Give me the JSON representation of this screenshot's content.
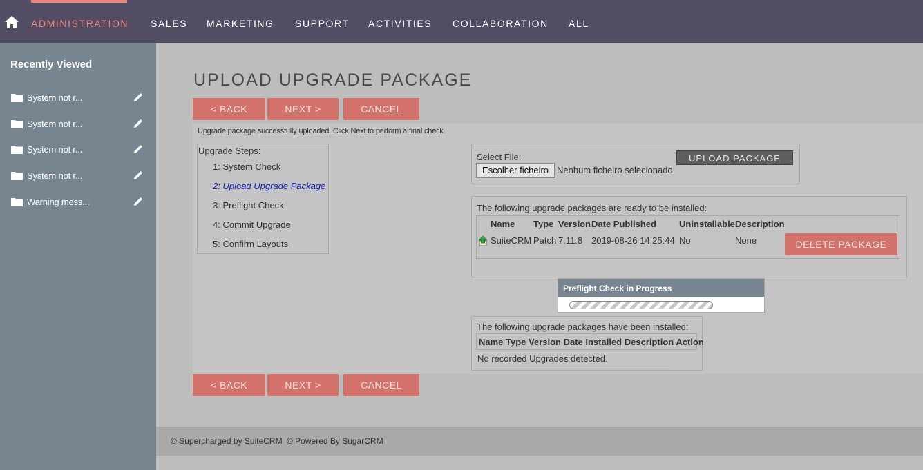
{
  "nav": {
    "items": [
      "ADMINISTRATION",
      "SALES",
      "MARKETING",
      "SUPPORT",
      "ACTIVITIES",
      "COLLABORATION",
      "ALL"
    ],
    "active": "ADMINISTRATION",
    "accent": "#f08377",
    "background": "#534d64"
  },
  "sidebar": {
    "title": "Recently Viewed",
    "items": [
      {
        "label": "System not r..."
      },
      {
        "label": "System not r..."
      },
      {
        "label": "System not r..."
      },
      {
        "label": "System not r..."
      },
      {
        "label": "Warning mess..."
      }
    ]
  },
  "page": {
    "title": "UPLOAD UPGRADE PACKAGE",
    "back_label": "< BACK",
    "next_label": "NEXT >",
    "cancel_label": "CANCEL",
    "message": "Upgrade package successfully uploaded. Click Next to perform a final check."
  },
  "steps": {
    "header": "Upgrade Steps:",
    "items": [
      "1: System Check",
      "2: Upload Upgrade Package",
      "3: Preflight Check",
      "4: Commit Upgrade",
      "5: Confirm Layouts"
    ],
    "current_index": 1
  },
  "upload": {
    "select_label": "Select File:",
    "choose_button": "Escolher ficheiro",
    "no_file": "Nenhum ficheiro selecionado",
    "upload_button": "UPLOAD PACKAGE"
  },
  "ready": {
    "caption": "The following upgrade packages are ready to be installed:",
    "headers": {
      "name": "Name",
      "type": "Type",
      "version": "Version",
      "date": "Date Published",
      "uninstallable": "Uninstallable",
      "description": "Description"
    },
    "row": {
      "name": "SuiteCRM",
      "type": "Patch",
      "version": "7.11.8",
      "date": "2019-08-26 14:25:44",
      "uninstallable": "No",
      "description": "None"
    },
    "delete_button": "DELETE PACKAGE"
  },
  "preflight": {
    "title": "Preflight Check in Progress"
  },
  "installed": {
    "caption": "The following upgrade packages have been installed:",
    "header": "Name Type Version Date Installed Description Action",
    "empty": "No recorded Upgrades detected."
  },
  "footer": {
    "suite": "© Supercharged by SuiteCRM",
    "sugar": "© Powered By SugarCRM"
  }
}
